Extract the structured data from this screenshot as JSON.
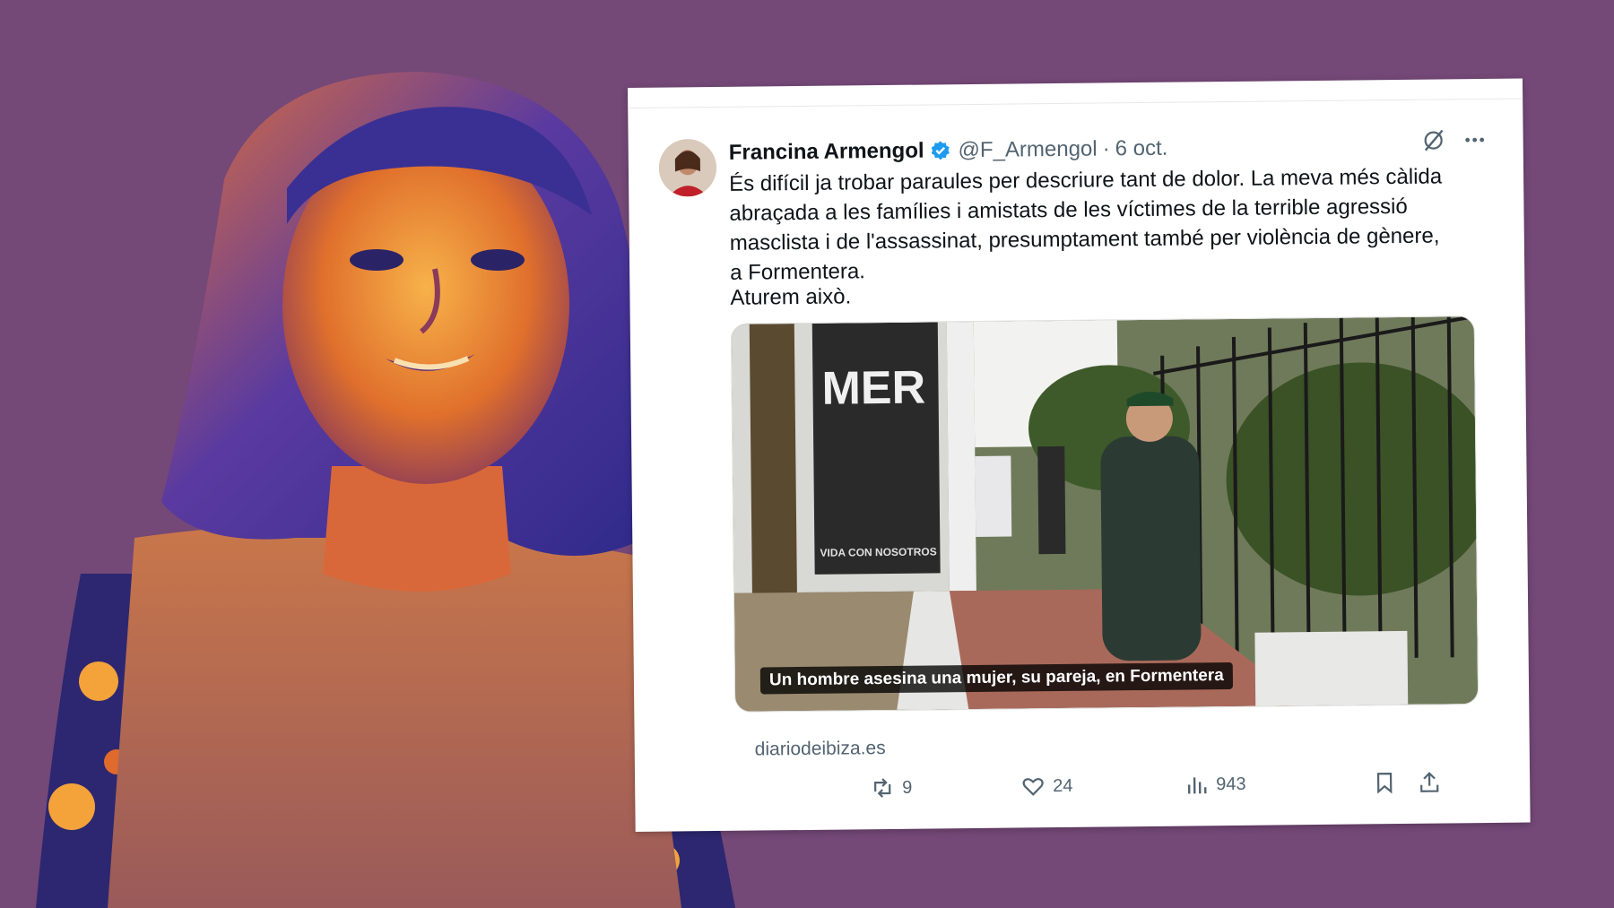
{
  "colors": {
    "background": "#744877",
    "verified": "#1d9bf0",
    "text": "#0f1419",
    "muted": "#536471"
  },
  "tweet": {
    "author_name": "Francina Armengol",
    "handle": "@F_Armengol",
    "separator": "·",
    "date": "6 oct.",
    "text": "És difícil ja trobar paraules per descriure tant de dolor. La meva més càlida\nabraçada a les famílies i amistats de les víctimes de la terrible agressió\nmasclista i de l'assassinat, presumptament també per violència de gènere,\na Formentera.",
    "text2": "Aturem això.",
    "media_caption": "Un hombre asesina una mujer, su pareja, en Formentera",
    "media_sign_text": "MER",
    "media_sign_text_small": "VIDA CON NOSOTROS",
    "link_source": "diariodeibiza.es",
    "retweets": "9",
    "likes": "24",
    "views": "943",
    "icons": [
      "verified-badge-icon",
      "grok-icon",
      "more-icon",
      "retweet-icon",
      "like-icon",
      "views-icon",
      "bookmark-icon",
      "share-icon"
    ]
  }
}
